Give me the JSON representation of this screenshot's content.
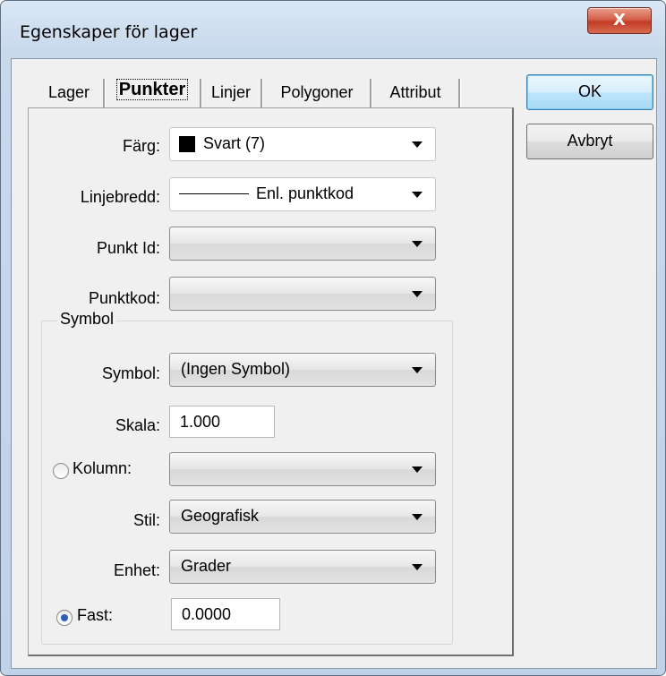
{
  "window": {
    "title": "Egenskaper för lager",
    "close_glyph": "X"
  },
  "tabs": [
    "Lager",
    "Punkter",
    "Linjer",
    "Polygoner",
    "Attribut"
  ],
  "form": {
    "farg_label": "Färg:",
    "farg_value": "Svart (7)",
    "farg_swatch_color": "#000000",
    "linjebredd_label": "Linjebredd:",
    "linjebredd_value": "Enl. punktkod",
    "punktid_label": "Punkt Id:",
    "punktid_value": "",
    "punktkod_label": "Punktkod:",
    "punktkod_value": ""
  },
  "symbol": {
    "group_label": "Symbol",
    "symbol_label": "Symbol:",
    "symbol_value": "(Ingen Symbol)",
    "skala_label": "Skala:",
    "skala_value": "1.000",
    "kolumn_label": "Kolumn:",
    "kolumn_value": "",
    "kolumn_selected": false,
    "stil_label": "Stil:",
    "stil_value": "Geografisk",
    "enhet_label": "Enhet:",
    "enhet_value": "Grader",
    "fast_label": "Fast:",
    "fast_value": "0.0000",
    "fast_selected": true
  },
  "buttons": {
    "ok": "OK",
    "cancel": "Avbryt"
  }
}
